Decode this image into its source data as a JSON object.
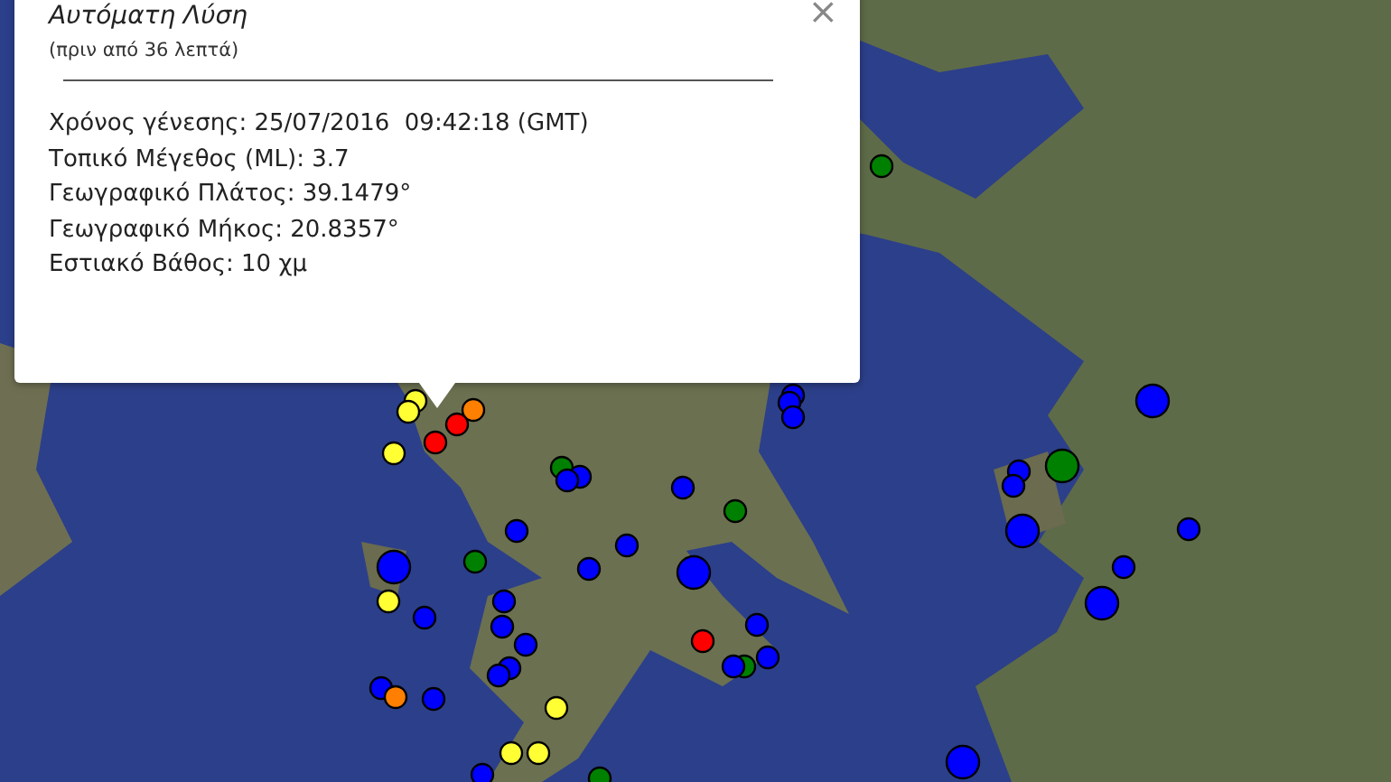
{
  "popup": {
    "title": "Αυτόματη Λύση",
    "subtitle": "(πριν από 36 λεπτά)",
    "close": "×",
    "lines": [
      "Χρόνος γένεσης: 25/07/2016  09:42:18 (GMT)",
      "Τοπικό Μέγεθος (ML): 3.7",
      "Γεωγραφικό Πλάτος: 39.1479°",
      "Γεωγραφικό Μήκος: 20.8357°",
      "Εστιακό Βάθος: 10 χμ"
    ]
  },
  "markers": [
    {
      "color": "#ffff33",
      "kind": "small"
    },
    {
      "color": "#ffff33",
      "kind": "small"
    },
    {
      "color": "#ffff33",
      "kind": "small"
    },
    {
      "color": "#ff7f00",
      "kind": "small"
    },
    {
      "color": "#ff0000",
      "kind": "small"
    },
    {
      "color": "#ff0000",
      "kind": "small"
    },
    {
      "color": "#008000",
      "kind": "small"
    },
    {
      "color": "#0000ff",
      "kind": "small"
    },
    {
      "color": "#0000ff",
      "kind": "small"
    },
    {
      "color": "#0000ff",
      "kind": "small"
    },
    {
      "color": "#008000",
      "kind": "small"
    },
    {
      "color": "#0000ff",
      "kind": "small"
    },
    {
      "color": "#0000ff",
      "kind": "large"
    },
    {
      "color": "#008000",
      "kind": "small"
    },
    {
      "color": "#0000ff",
      "kind": "small"
    },
    {
      "color": "#0000ff",
      "kind": "small"
    },
    {
      "color": "#0000ff",
      "kind": "large"
    },
    {
      "color": "#ffff33",
      "kind": "small"
    },
    {
      "color": "#0000ff",
      "kind": "small"
    },
    {
      "color": "#0000ff",
      "kind": "small"
    },
    {
      "color": "#0000ff",
      "kind": "small"
    },
    {
      "color": "#0000ff",
      "kind": "small"
    },
    {
      "color": "#ff0000",
      "kind": "small"
    },
    {
      "color": "#0000ff",
      "kind": "small"
    },
    {
      "color": "#008000",
      "kind": "small"
    },
    {
      "color": "#0000ff",
      "kind": "small"
    },
    {
      "color": "#0000ff",
      "kind": "small"
    },
    {
      "color": "#0000ff",
      "kind": "small"
    },
    {
      "color": "#0000ff",
      "kind": "small"
    },
    {
      "color": "#0000ff",
      "kind": "small"
    },
    {
      "color": "#ff7f00",
      "kind": "small"
    },
    {
      "color": "#0000ff",
      "kind": "small"
    },
    {
      "color": "#ffff33",
      "kind": "small"
    },
    {
      "color": "#ffff33",
      "kind": "small"
    },
    {
      "color": "#ffff33",
      "kind": "small"
    },
    {
      "color": "#0000ff",
      "kind": "small"
    },
    {
      "color": "#008000",
      "kind": "small"
    },
    {
      "color": "#0000ff",
      "kind": "small"
    },
    {
      "color": "#0000ff",
      "kind": "small"
    },
    {
      "color": "#0000ff",
      "kind": "small"
    },
    {
      "color": "#0000ff",
      "kind": "large"
    },
    {
      "color": "#008000",
      "kind": "large"
    },
    {
      "color": "#0000ff",
      "kind": "small"
    },
    {
      "color": "#0000ff",
      "kind": "small"
    },
    {
      "color": "#0000ff",
      "kind": "large"
    },
    {
      "color": "#0000ff",
      "kind": "small"
    },
    {
      "color": "#0000ff",
      "kind": "small"
    },
    {
      "color": "#0000ff",
      "kind": "large"
    },
    {
      "color": "#0000ff",
      "kind": "large"
    },
    {
      "color": "#008000",
      "kind": "small"
    }
  ]
}
